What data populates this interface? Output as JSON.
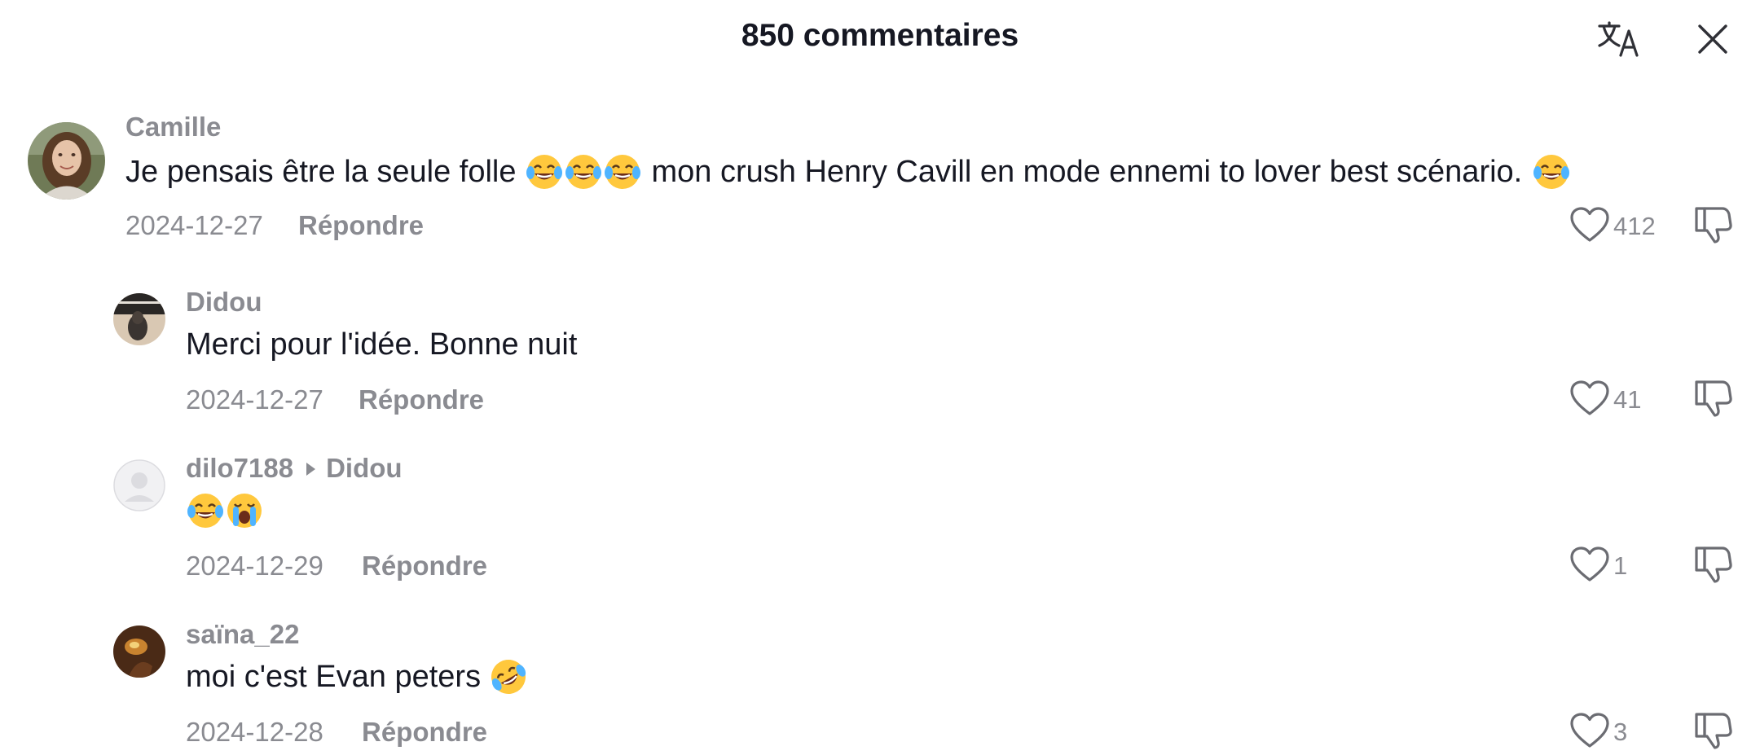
{
  "header": {
    "title": "850 commentaires",
    "translate_icon": "translate-icon",
    "close_icon": "close-icon"
  },
  "comments": [
    {
      "username": "Camille",
      "text_before": "Je pensais être la seule folle",
      "text_after": "mon crush Henry Cavill en mode ennemi to lover best scénario.",
      "date": "2024-12-27",
      "reply_label": "Répondre",
      "likes": "412"
    },
    {
      "username": "Didou",
      "text": "Merci pour l'idée. Bonne nuit",
      "date": "2024-12-27",
      "reply_label": "Répondre",
      "likes": "41"
    },
    {
      "username": "dilo7188",
      "reply_to": "Didou",
      "date": "2024-12-29",
      "reply_label": "Répondre",
      "likes": "1"
    },
    {
      "username": "saïna_22",
      "text": "moi c'est Evan peters",
      "date": "2024-12-28",
      "reply_label": "Répondre",
      "likes": "3"
    }
  ],
  "colors": {
    "text_primary": "#161823",
    "text_secondary": "#8a8b91",
    "background": "#ffffff"
  }
}
